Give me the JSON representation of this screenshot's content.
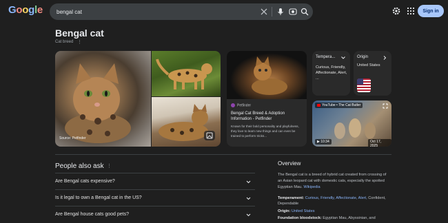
{
  "header": {
    "logo_letters": [
      "G",
      "o",
      "o",
      "g",
      "l",
      "e"
    ],
    "logo_colors": [
      "#8ab4f8",
      "#f28b82",
      "#fdd663",
      "#8ab4f8",
      "#81c995",
      "#f28b82"
    ],
    "search_value": "bengal cat",
    "signin_label": "Sign in"
  },
  "entity": {
    "title": "Bengal cat",
    "subtitle": "Cat breed"
  },
  "images": {
    "source_caption": "Source: Petfinder"
  },
  "petfinder_card": {
    "source": "Petfinder",
    "title": "Bengal Cat Breed & Adoption Information - Petfinder",
    "description": "Known for their bold personality and playfulness, they love to learn new things and can even be trained to perform tricks..."
  },
  "attributes": {
    "temperament_label": "Tempera...",
    "temperament_value": "Curious, Friendly, Affectionate, Alert, ...",
    "origin_label": "Origin",
    "origin_value": "United States"
  },
  "video": {
    "channel": "YouTube • The Cat Butler",
    "duration": "10:34",
    "date": "Oct 17, 2025"
  },
  "people_also_ask": {
    "title": "People also ask",
    "questions": [
      "Are Bengal cats expensive?",
      "Is it legal to own a Bengal cat in the US?",
      "Are Bengal house cats good pets?"
    ]
  },
  "overview": {
    "title": "Overview",
    "text": "The Bengal cat is a breed of hybrid cat created from crossing of an Asian leopard cat with domestic cats, especially the spotted Egyptian Mau.",
    "wiki_link": "Wikipedia",
    "temperament_label": "Temperament:",
    "temperament_links": "Curious, Friendly, Affectionate, Alert,",
    "temperament_rest": "Confident, Dependable",
    "origin_label": "Origin:",
    "origin_value": "United States",
    "bloodstock_label": "Foundation bloodstock:",
    "bloodstock_value": "Egyptian Mau, Abyssinian, and"
  },
  "colors": {
    "background": "#1f1f1f",
    "link": "#8ab4f8",
    "signin_bg": "#a8c7fa"
  }
}
